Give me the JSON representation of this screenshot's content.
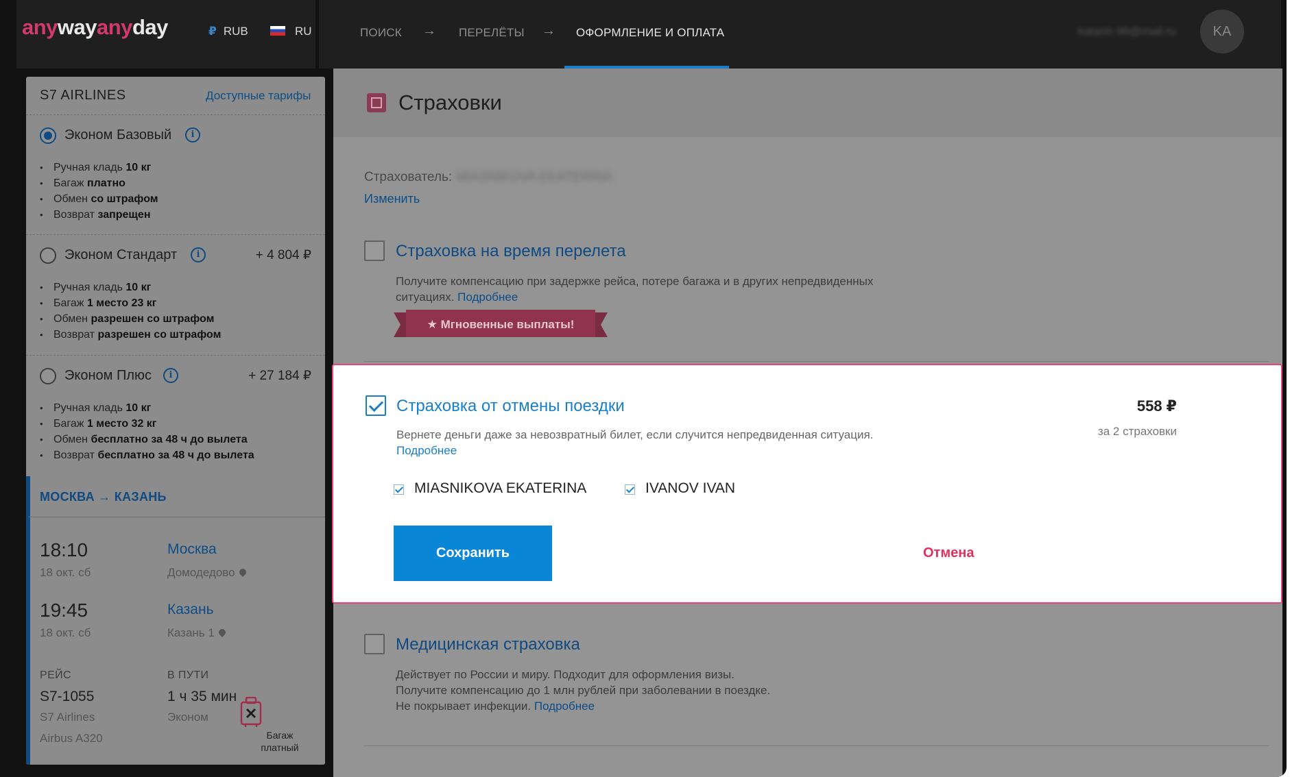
{
  "header": {
    "brand_any1": "any",
    "brand_way": "way",
    "brand_any2": "any",
    "brand_day": "day",
    "currency_symbol": "₽",
    "currency": "RUB",
    "language": "RU",
    "steps": [
      {
        "label": "ПОИСК"
      },
      {
        "label": "ПЕРЕЛЁТЫ"
      },
      {
        "label": "ОФОРМЛЕНИЕ И ОПЛАТА",
        "active": true
      }
    ],
    "step_arrow": "→",
    "user_email": "katarin.98@mail.ru",
    "avatar_initials": "KA"
  },
  "sidebar": {
    "airline": "S7 AIRLINES",
    "fares_link": "Доступные тарифы",
    "fares": [
      {
        "name": "Эконом Базовый",
        "selected": true,
        "price": "",
        "features": [
          {
            "pre": "Ручная кладь ",
            "bold": "10 кг"
          },
          {
            "pre": "Багаж ",
            "bold": "платно"
          },
          {
            "pre": "Обмен ",
            "bold": "со штрафом"
          },
          {
            "pre": "Возврат ",
            "bold": "запрещен"
          }
        ]
      },
      {
        "name": "Эконом Стандарт",
        "selected": false,
        "price": "+ 4 804 ₽",
        "features": [
          {
            "pre": "Ручная кладь ",
            "bold": "10 кг"
          },
          {
            "pre": "Багаж ",
            "bold": "1 место 23 кг"
          },
          {
            "pre": "Обмен ",
            "bold": "разрешен со штрафом"
          },
          {
            "pre": "Возврат ",
            "bold": "разрешен со штрафом"
          }
        ]
      },
      {
        "name": "Эконом Плюс",
        "selected": false,
        "price": "+ 27 184 ₽",
        "features": [
          {
            "pre": "Ручная кладь ",
            "bold": "10 кг"
          },
          {
            "pre": "Багаж ",
            "bold": "1 место 32 кг"
          },
          {
            "pre": "Обмен ",
            "bold": "бесплатно за 48 ч до вылета"
          },
          {
            "pre": "Возврат ",
            "bold": "бесплатно за 48 ч до вылета"
          }
        ]
      }
    ],
    "route": "МОСКВА → КАЗАНЬ",
    "departure": {
      "time": "18:10",
      "date": "18 окт. сб",
      "city": "Москва",
      "airport": "Домодедово"
    },
    "arrival": {
      "time": "19:45",
      "date": "18 окт. сб",
      "city": "Казань",
      "airport": "Казань 1"
    },
    "flight": {
      "label": "РЕЙС",
      "number": "S7-1055",
      "carrier": "S7 Airlines",
      "aircraft": "Airbus A320"
    },
    "duration": {
      "label": "В ПУТИ",
      "value": "1 ч 35 мин",
      "cabin": "Эконом"
    },
    "baggage_line1": "Багаж",
    "baggage_line2": "платный"
  },
  "main": {
    "title": "Страховки",
    "insurer_label": "Страхователь:",
    "insurer_name": "MIASNIKOVA EKATERINA",
    "change_link": "Изменить",
    "options": [
      {
        "title": "Страховка на время перелета",
        "checked": false,
        "desc_line1": "Получите компенсацию при задержке рейса, потере багажа и в других непредвиденных",
        "desc_line2": "ситуациях.",
        "more": "Подробнее",
        "badge": "★ Мгновенные выплаты!"
      },
      {
        "title": "Страховка от отмены поездки",
        "checked": true,
        "price": "558 ₽",
        "price_sub": "за 2 страховки",
        "desc_line1": "Вернете деньги даже за невозвратный билет, если случится непредвиденная ситуация.",
        "more": "Подробнее",
        "passengers": [
          {
            "name": "MIASNIKOVA EKATERINA",
            "checked": true
          },
          {
            "name": "IVANOV IVAN",
            "checked": true
          }
        ],
        "save_label": "Сохранить",
        "cancel_label": "Отмена"
      },
      {
        "title": "Медицинская страховка",
        "checked": false,
        "desc_line1": "Действует по России и миру. Подходит для оформления визы.",
        "desc_line2": "Получите компенсацию до 1 млн рублей при заболевании в поездке.",
        "desc_line3": "Не покрывает инфекции.",
        "more": "Подробнее"
      }
    ]
  },
  "colors": {
    "accent_blue": "#1a7fc9",
    "brand_pink": "#d23a6c",
    "cancel_red": "#e0315f",
    "highlight_border": "#e8467a",
    "save_button": "#0a86d6"
  }
}
